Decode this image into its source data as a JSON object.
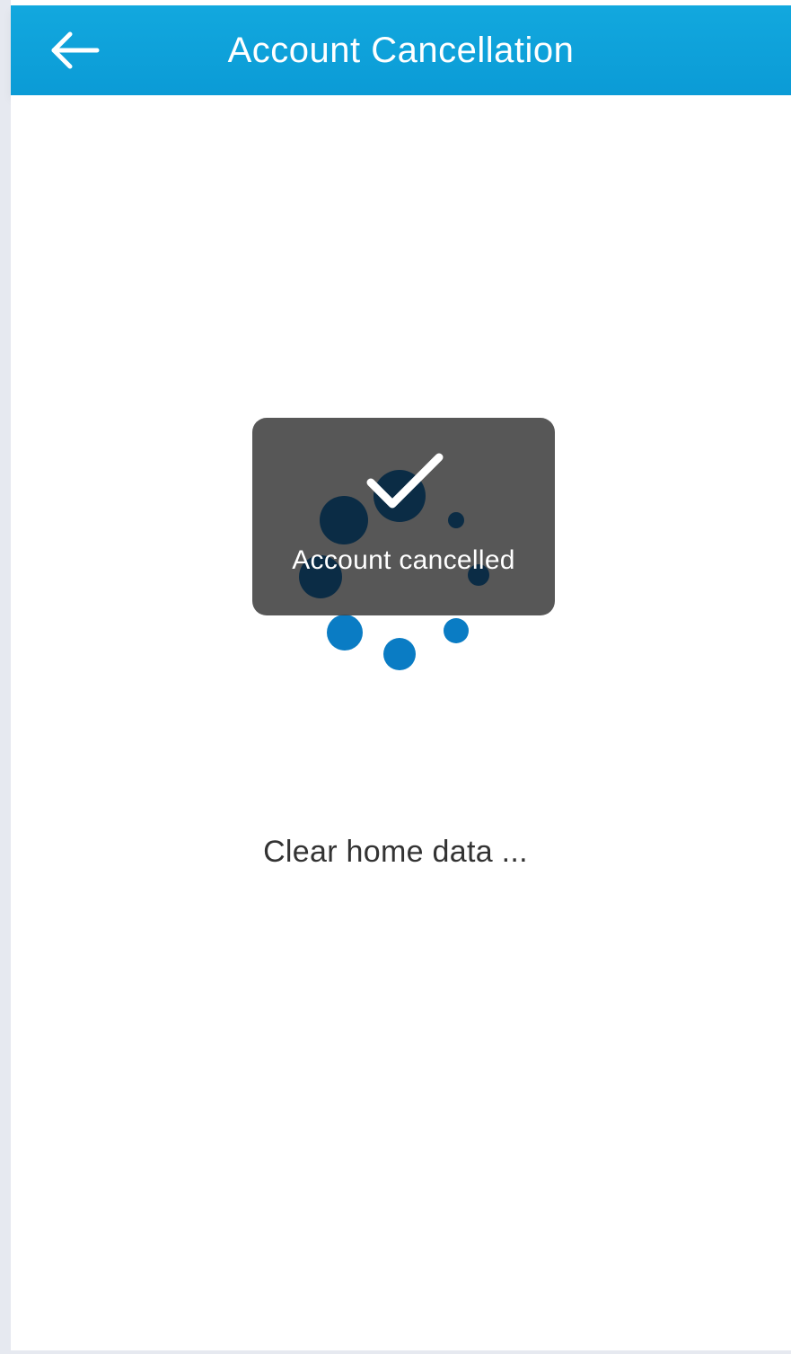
{
  "header": {
    "title": "Account Cancellation",
    "back_icon": "arrow-left-icon",
    "background_color": "#0ea3dc"
  },
  "toast": {
    "message": "Account cancelled",
    "icon": "checkmark-icon"
  },
  "loading": {
    "status_text": "Clear home data ...",
    "spinner_color": "#0a7cc4"
  }
}
